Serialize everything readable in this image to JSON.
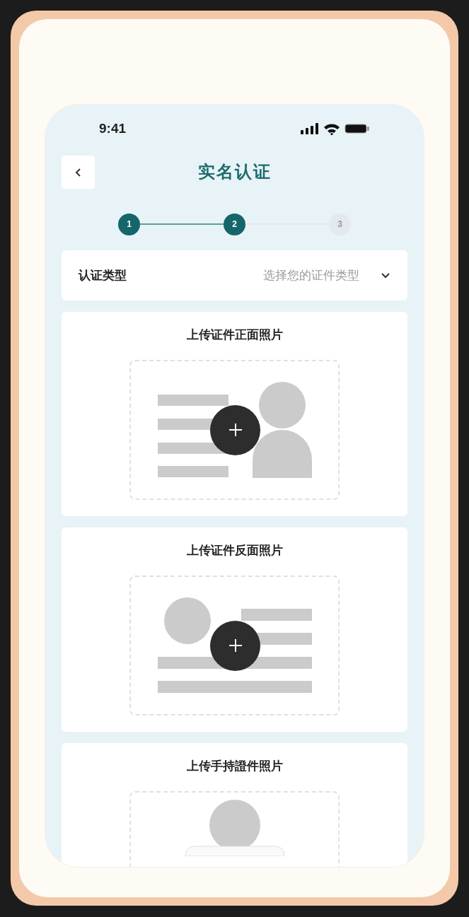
{
  "status_bar": {
    "time": "9:41"
  },
  "header": {
    "title": "实名认证"
  },
  "steps": [
    {
      "label": "1",
      "active": true
    },
    {
      "label": "2",
      "active": true
    },
    {
      "label": "3",
      "active": false
    }
  ],
  "select": {
    "label": "认证类型",
    "placeholder": "选择您的证件类型"
  },
  "uploads": [
    {
      "title": "上传证件正面照片",
      "kind": "front"
    },
    {
      "title": "上传证件反面照片",
      "kind": "back"
    },
    {
      "title": "上传手持證件照片",
      "kind": "handheld"
    }
  ]
}
